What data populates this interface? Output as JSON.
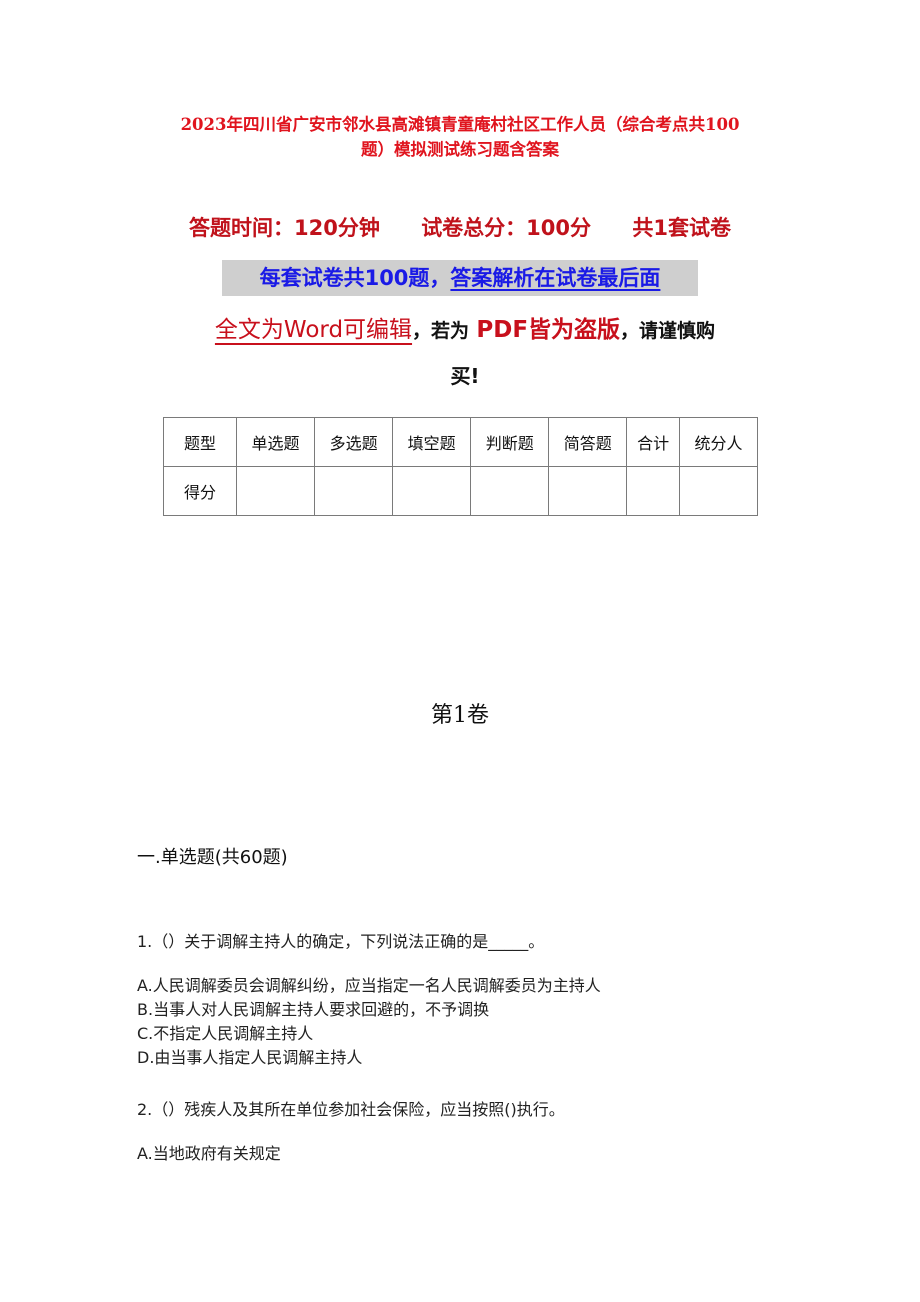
{
  "document": {
    "title_line1": "2023年四川省广安市邻水县高滩镇青童庵村社区工作人员（综合考点共100",
    "title_line2": "题）模拟测试练习题含答案",
    "meta": {
      "time": "答题时间：120分钟",
      "total_score": "试卷总分：100分",
      "sets": "共1套试卷"
    },
    "notice_blue": {
      "part1": "每套试卷共100题，",
      "part2": "答案解析在试卷最后面"
    },
    "warning": {
      "part1": "全文为Word可编辑",
      "part2": "，若为",
      "part3": "PDF皆为盗版",
      "part4": "，请谨慎购",
      "line2": "买!"
    },
    "score_table": {
      "header": [
        "题型",
        "单选题",
        "多选题",
        "填空题",
        "判断题",
        "简答题",
        "合计",
        "统分人"
      ],
      "row": [
        "得分",
        "",
        "",
        "",
        "",
        "",
        "",
        ""
      ]
    },
    "volume_title": "第1卷",
    "section_title": "一.单选题(共60题)",
    "questions": [
      {
        "stem": "1.（）关于调解主持人的确定，下列说法正确的是_____。",
        "options": [
          "A.人民调解委员会调解纠纷，应当指定一名人民调解委员为主持人",
          "B.当事人对人民调解主持人要求回避的，不予调换",
          "C.不指定人民调解主持人",
          "D.由当事人指定人民调解主持人"
        ]
      },
      {
        "stem": "2.（）残疾人及其所在单位参加社会保险，应当按照()执行。",
        "options": [
          "A.当地政府有关规定"
        ]
      }
    ]
  }
}
